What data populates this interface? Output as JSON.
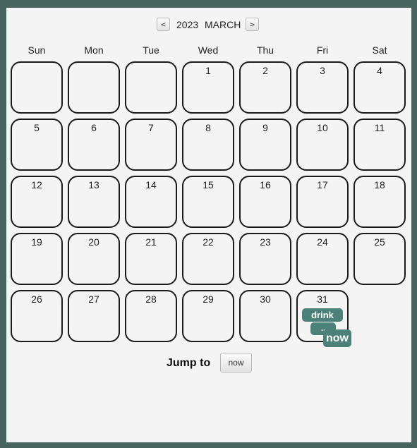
{
  "header": {
    "prev_label": "<",
    "next_label": ">",
    "year": "2023",
    "month": "MARCH"
  },
  "weekdays": [
    "Sun",
    "Mon",
    "Tue",
    "Wed",
    "Thu",
    "Fri",
    "Sat"
  ],
  "weeks": [
    [
      "",
      "",
      "",
      "1",
      "2",
      "3",
      "4"
    ],
    [
      "5",
      "6",
      "7",
      "8",
      "9",
      "10",
      "11"
    ],
    [
      "12",
      "13",
      "14",
      "15",
      "16",
      "17",
      "18"
    ],
    [
      "19",
      "20",
      "21",
      "22",
      "23",
      "24",
      "25"
    ],
    [
      "26",
      "27",
      "28",
      "29",
      "30",
      "31",
      null
    ]
  ],
  "events": [
    {
      "day": "31",
      "label": "drink"
    },
    {
      "day": "31",
      "label": ".."
    },
    {
      "day": "31",
      "label": "now"
    }
  ],
  "footer": {
    "jump_label": "Jump to",
    "now_button": "now"
  },
  "colors": {
    "accent": "#4b8178",
    "window_border": "#47655e"
  }
}
